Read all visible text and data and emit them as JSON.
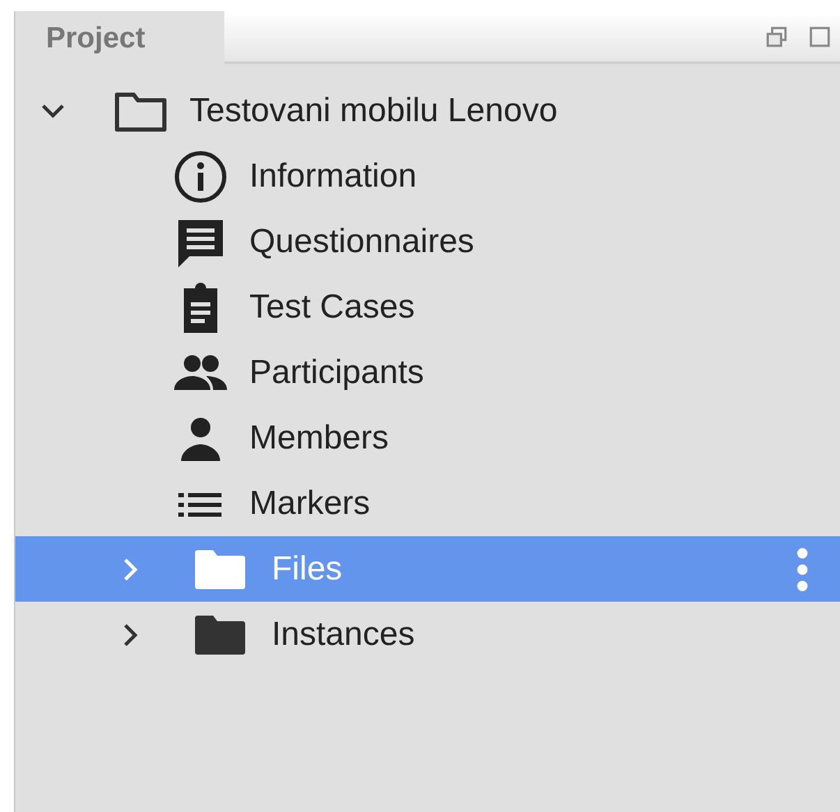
{
  "panel": {
    "tab": {
      "label": "Project",
      "selected": true
    }
  },
  "tree": {
    "label": "Testovani mobilu Lenovo",
    "expanded": true,
    "selected": false,
    "children": [
      {
        "label": "Information",
        "kind": "info",
        "selected": false
      },
      {
        "label": "Questionnaires",
        "kind": "comment",
        "selected": false
      },
      {
        "label": "Test Cases",
        "kind": "clipboard",
        "selected": false
      },
      {
        "label": "Participants",
        "kind": "people",
        "selected": false
      },
      {
        "label": "Members",
        "kind": "person",
        "selected": false
      },
      {
        "label": "Markers",
        "kind": "list",
        "selected": false
      },
      {
        "label": "Files",
        "kind": "folder",
        "expanded": false,
        "selected": true
      },
      {
        "label": "Instances",
        "kind": "folder",
        "expanded": false,
        "selected": false
      }
    ]
  }
}
